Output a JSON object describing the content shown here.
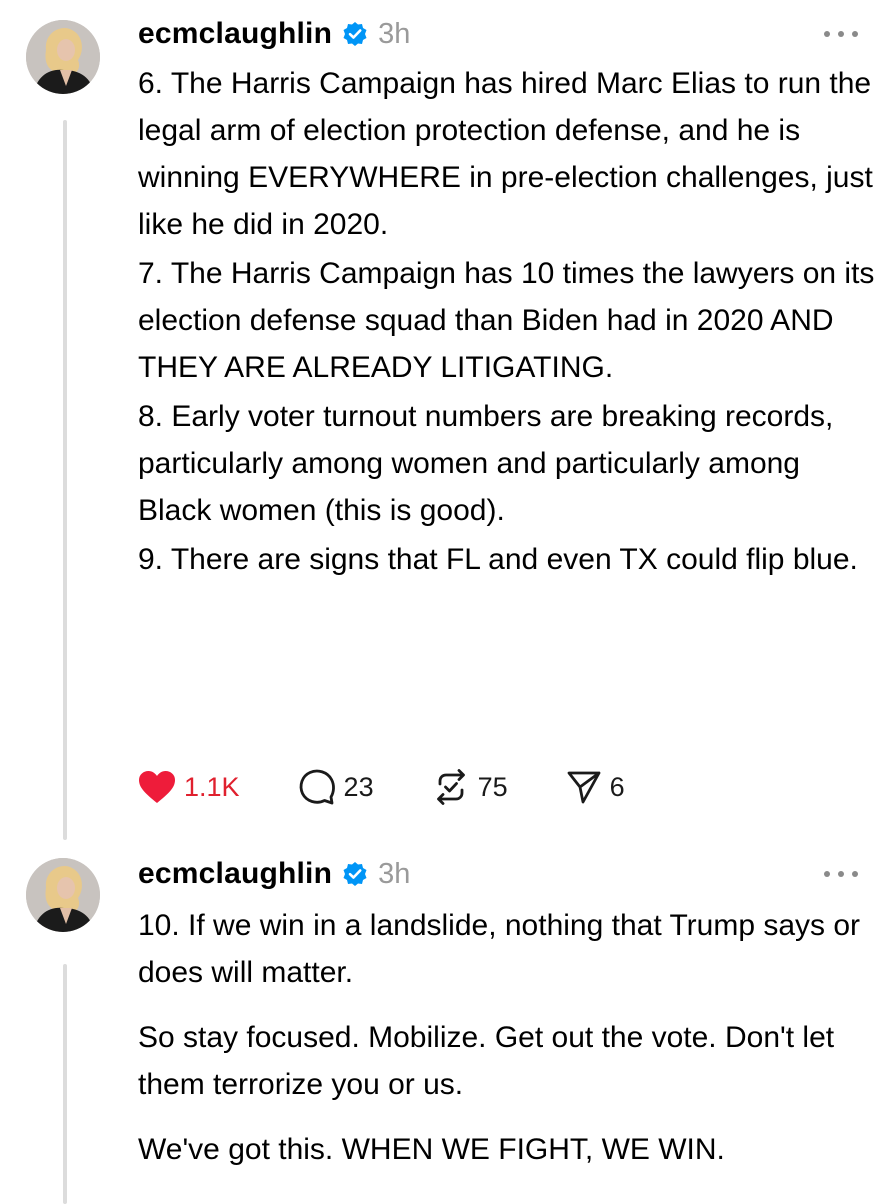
{
  "posts": [
    {
      "username": "ecmclaughlin",
      "time": "3h",
      "paragraphs": [
        "6. The Harris Campaign has hired Marc Elias to run the legal arm of election protection defense, and he is winning EVERYWHERE in pre-election challenges, just like he did in 2020.",
        "7. The Harris Campaign has 10 times the lawyers on its election defense squad than Biden had in 2020 AND THEY ARE ALREADY LITIGATING.",
        "8. Early voter turnout numbers are breaking records, particularly among women and particularly among Black women (this is good).",
        "9. There are signs that FL and even TX could flip blue."
      ],
      "likes": "1.1K",
      "replies": "23",
      "reposts": "75",
      "shares": "6"
    },
    {
      "username": "ecmclaughlin",
      "time": "3h",
      "paragraphs": [
        "10. If we win in a landslide, nothing that Trump says or does will matter.",
        "So stay focused. Mobilize. Get out the vote. Don't let them terrorize you or us.",
        "We've got this. WHEN WE FIGHT, WE WIN."
      ]
    }
  ],
  "icons": {
    "like": "heart-icon",
    "reply": "comment-icon",
    "repost": "repost-icon",
    "share": "send-icon",
    "verified": "verified-badge-icon",
    "more": "more-dots-icon"
  },
  "colors": {
    "like": "#ee1c3a",
    "verified": "#0095f6",
    "muted": "#9a9a9a",
    "thread_line": "#dcdcdc"
  }
}
